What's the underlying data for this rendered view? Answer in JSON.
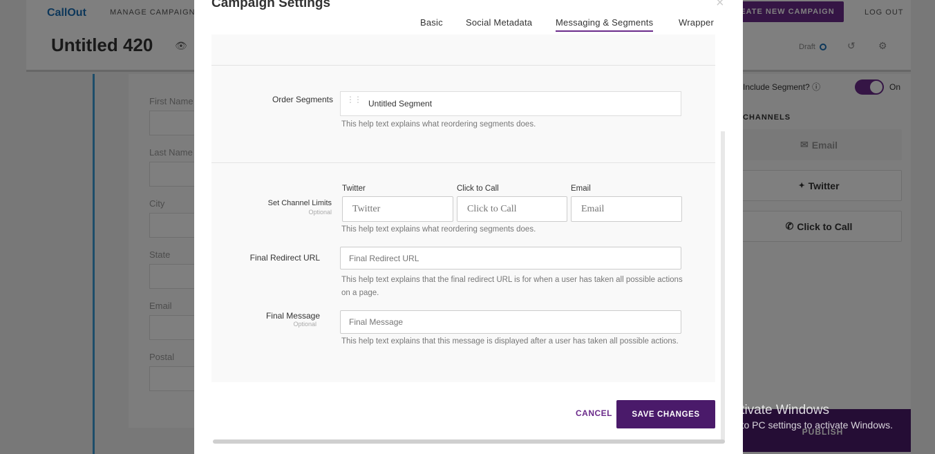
{
  "app": {
    "logo": "CallOut",
    "nav_manage": "MANAGE CAMPAIGNS",
    "create_button": "EATE NEW CAMPAIGN",
    "logout": "LOG OUT",
    "campaign_title": "Untitled 420",
    "status": "Draft"
  },
  "background_form": {
    "fields": [
      "First Name",
      "Last Name",
      "City",
      "State",
      "Email",
      "Postal"
    ]
  },
  "right_panel": {
    "include_segment_label": "Include Segment?",
    "include_segment_state": "On",
    "channels_heading": "CHANNELS",
    "channels": [
      {
        "label": "Email",
        "icon": "envelope-icon",
        "enabled": false
      },
      {
        "label": "Twitter",
        "icon": "twitter-icon",
        "enabled": true
      },
      {
        "label": "Click to Call",
        "icon": "phone-icon",
        "enabled": true
      }
    ],
    "publish": "PUBLISH"
  },
  "modal": {
    "title": "Campaign Settings",
    "tabs": [
      {
        "label": "Basic",
        "active": false
      },
      {
        "label": "Social Metadata",
        "active": false
      },
      {
        "label": "Messaging & Segments",
        "active": true
      },
      {
        "label": "Wrapper",
        "active": false
      }
    ],
    "order_segments": {
      "label": "Order Segments",
      "segment": "Untitled Segment",
      "help": "This help text explains what reordering segments does."
    },
    "channel_limits": {
      "label": "Set Channel Limits",
      "sub": "Optional",
      "columns": [
        {
          "label": "Twitter",
          "placeholder": "Twitter"
        },
        {
          "label": "Click to Call",
          "placeholder": "Click to Call"
        },
        {
          "label": "Email",
          "placeholder": "Email"
        }
      ],
      "help": "This help text explains what reordering segments does."
    },
    "redirect": {
      "label": "Final Redirect URL",
      "placeholder": "Final Redirect URL",
      "help": "This help text explains that the final redirect URL is for when a user has taken all possible actions on a page."
    },
    "final_message": {
      "label": "Final Message",
      "sub": "Optional",
      "placeholder": "Final Message",
      "help": "This help text explains that this message is displayed after a user has taken all possible actions."
    },
    "cancel": "CANCEL",
    "save": "SAVE CHANGES"
  },
  "watermark": {
    "title": "Activate Windows",
    "subtitle": "Go to PC settings to activate Windows."
  },
  "colors": {
    "accent": "#6a2a8a",
    "primary_dark": "#4a1a6a",
    "link_blue": "#1a6fb5"
  }
}
